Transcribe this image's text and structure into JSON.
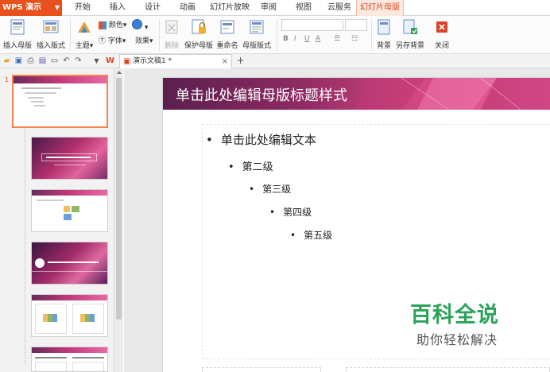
{
  "app": {
    "brand_label": "WPS 演示",
    "brand_color": "#e8501e",
    "accent_color": "#d9431a"
  },
  "menu": {
    "items": [
      "开始",
      "插入",
      "设计",
      "动画",
      "幻灯片放映",
      "审阅",
      "视图",
      "云服务",
      "幻灯片母版"
    ],
    "active": "幻灯片母版"
  },
  "ribbon": {
    "insert_master": "插入母版",
    "insert_layout": "插入版式",
    "theme": "主题",
    "colors": "颜色",
    "fonts": "字体",
    "effects": "效果",
    "delete": "删除",
    "protect_master": "保护母版",
    "rename": "重命名",
    "master_layout": "母版版式",
    "bold": "B",
    "italic": "I",
    "underline": "U",
    "font_color": "A",
    "background": "背景",
    "save_background": "另存背景",
    "close": "关闭"
  },
  "tabs": {
    "document_title": "演示文稿1 *",
    "close_glyph": "×",
    "new_tab_glyph": "+"
  },
  "thumbnails": {
    "first_slide_number": "1"
  },
  "slide": {
    "title": "单击此处编辑母版标题样式",
    "levels": [
      "单击此处编辑文本",
      "第二级",
      "第三级",
      "第四级",
      "第五级"
    ]
  },
  "watermark": {
    "line1": "百科全说",
    "line2": "助你轻松解决"
  }
}
